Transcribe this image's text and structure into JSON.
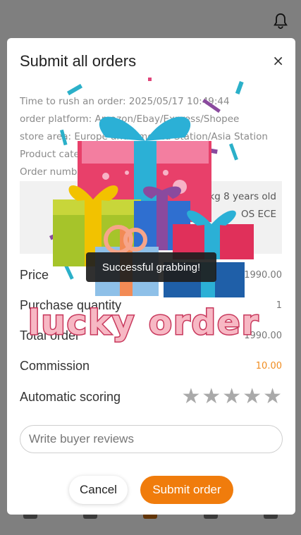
{
  "colors": {
    "accent": "#f07c0c",
    "commission": "#f08c20",
    "star": "#a9a9a9",
    "lucky_fill": "#f7b8c4",
    "lucky_stroke": "#c8385c"
  },
  "header": {
    "icon": "bell-icon"
  },
  "modal": {
    "title": "Submit all orders",
    "close_glyph": "×",
    "info_lines": [
      "Time to rush an order:  2025/05/17 10:49:44",
      "order platform:  Amazon/Ebay/Express/Shopee",
      "store area:  Europe and America Station/Asia Station",
      "Product category:",
      "Order number:"
    ],
    "product": {
      "line1": "25kg 8 years old",
      "line2": "OS ECE"
    },
    "price": {
      "label": "Price",
      "value": "1990.00"
    },
    "quantity": {
      "label": "Purchase quantity",
      "value": "1"
    },
    "total": {
      "label": "Total order",
      "value": "1990.00"
    },
    "commission": {
      "label": "Commission",
      "value": "10.00"
    },
    "scoring": {
      "label": "Automatic scoring",
      "stars": [
        "★",
        "★",
        "★",
        "★",
        "★"
      ]
    },
    "review": {
      "placeholder": "Write buyer reviews",
      "value": ""
    },
    "cancel_label": "Cancel",
    "submit_label": "Submit order"
  },
  "celebration": {
    "toast": "Successful grabbing!",
    "banner": "lucky order"
  }
}
